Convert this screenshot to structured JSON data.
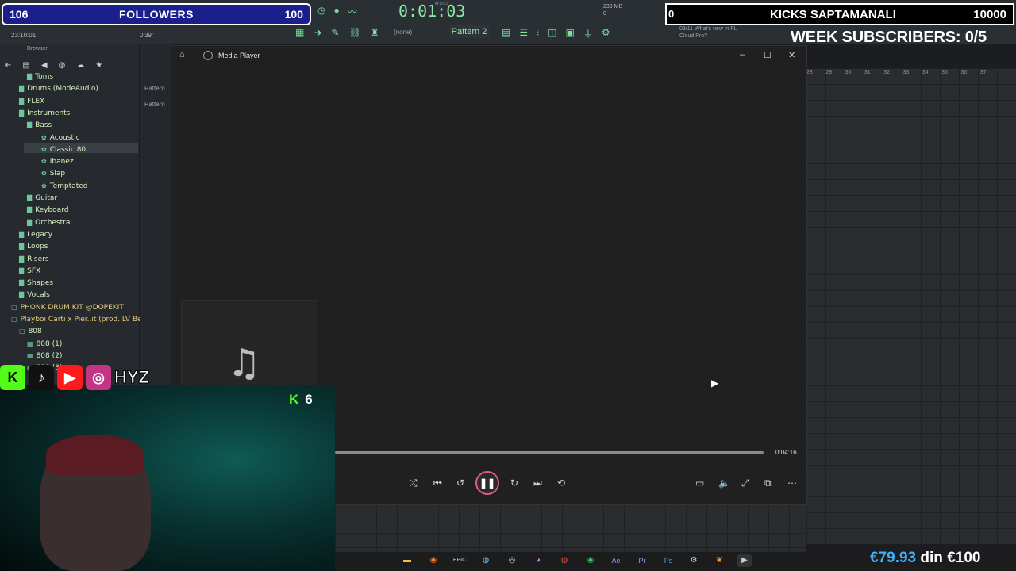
{
  "overlay": {
    "followers": {
      "current": "106",
      "label": "FOLLOWERS",
      "goal": "100"
    },
    "kicks": {
      "count": "0",
      "label": "KICKS SAPTAMANALI",
      "goal": "10000"
    },
    "week_subscribers": "WEEK SUBSCRIBERS: 0/5",
    "kick_viewers": "6",
    "handle": "HYZ",
    "donation": {
      "current": "€79.93",
      "sep": "din",
      "goal": "€100"
    },
    "social_icons": [
      "kick-icon",
      "tiktok-icon",
      "youtube-icon",
      "instagram-icon"
    ]
  },
  "fl": {
    "song_time": "0:01:03",
    "time_label": "M:S:CS",
    "clock": "23:10:01",
    "latency": "0'39\"",
    "pattern_label": "Pattern 2",
    "none_label": "(none)",
    "memory": "239 MB",
    "cpu": "0",
    "news_date": "03/11",
    "news_title": "What's new in FL",
    "news_sub": "Cloud Pro?",
    "bars": [
      "28",
      "29",
      "30",
      "31",
      "32",
      "33",
      "34",
      "35",
      "36",
      "37"
    ],
    "rack_labels": [
      "Pattern",
      "Pattern"
    ]
  },
  "browser": {
    "title": "Browser",
    "items": [
      {
        "label": "Toms",
        "level": 2,
        "type": "folder"
      },
      {
        "label": "Drums (ModeAudio)",
        "level": 1,
        "type": "folder"
      },
      {
        "label": "FLEX",
        "level": 1,
        "type": "folder"
      },
      {
        "label": "Instruments",
        "level": 1,
        "type": "folder"
      },
      {
        "label": "Bass",
        "level": 2,
        "type": "folder"
      },
      {
        "label": "Acoustic",
        "level": 3,
        "type": "preset"
      },
      {
        "label": "Classic 80",
        "level": 3,
        "type": "preset",
        "selected": true
      },
      {
        "label": "Ibanez",
        "level": 3,
        "type": "preset"
      },
      {
        "label": "Slap",
        "level": 3,
        "type": "preset"
      },
      {
        "label": "Temptated",
        "level": 3,
        "type": "preset"
      },
      {
        "label": "Guitar",
        "level": 2,
        "type": "folder"
      },
      {
        "label": "Keyboard",
        "level": 2,
        "type": "folder"
      },
      {
        "label": "Orchestral",
        "level": 2,
        "type": "folder"
      },
      {
        "label": "Legacy",
        "level": 1,
        "type": "folder"
      },
      {
        "label": "Loops",
        "level": 1,
        "type": "folder"
      },
      {
        "label": "Risers",
        "level": 1,
        "type": "folder"
      },
      {
        "label": "SFX",
        "level": 1,
        "type": "folder"
      },
      {
        "label": "Shapes",
        "level": 1,
        "type": "folder"
      },
      {
        "label": "Vocals",
        "level": 1,
        "type": "folder"
      },
      {
        "label": "PHONK DRUM KIT @DOPEKIT",
        "level": 0,
        "type": "pack"
      },
      {
        "label": "Playboi Carti x Pier..it (prod. LV Beats)",
        "level": 0,
        "type": "pack"
      },
      {
        "label": "808",
        "level": 1,
        "type": "pack"
      },
      {
        "label": "808 (1)",
        "level": 2,
        "type": "file"
      },
      {
        "label": "808 (2)",
        "level": 2,
        "type": "file"
      },
      {
        "label": "808 (3)",
        "level": 2,
        "type": "file"
      }
    ]
  },
  "media_player": {
    "title": "Media Player",
    "duration": "0:04:16",
    "progress": 1.0
  }
}
